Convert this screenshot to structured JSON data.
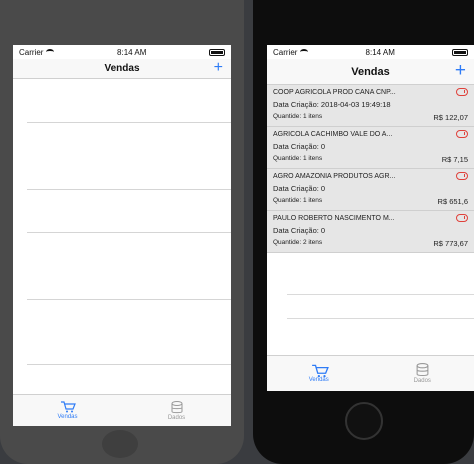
{
  "status": {
    "carrier": "Carrier",
    "time": "8:14 AM"
  },
  "navbar": {
    "title": "Vendas",
    "add_label": "+"
  },
  "tabs": [
    {
      "label": "Vendas",
      "icon": "cart-icon",
      "active": true
    },
    {
      "label": "Dados",
      "icon": "database-icon",
      "active": false
    }
  ],
  "sales": [
    {
      "name": "COOP AGRICOLA PROD CANA CNP...",
      "date": "Data Criação: 2018-04-03 19:49:18",
      "qty": "Quantide: 1 itens",
      "total": "R$ 122,07"
    },
    {
      "name": "AGRICOLA CACHIMBO VALE DO A...",
      "date": "Data Criação: 0",
      "qty": "Quantide: 1 itens",
      "total": "R$ 7,15"
    },
    {
      "name": "AGRO AMAZONIA PRODUTOS AGR...",
      "date": "Data Criação: 0",
      "qty": "Quantide: 1 itens",
      "total": "R$ 651,6"
    },
    {
      "name": "PAULO ROBERTO NASCIMENTO M...",
      "date": "Data Criação: 0",
      "qty": "Quantide: 2 itens",
      "total": "R$ 773,67"
    }
  ],
  "colors": {
    "accent": "#2f7cf6",
    "sync_error": "#e0403a"
  }
}
